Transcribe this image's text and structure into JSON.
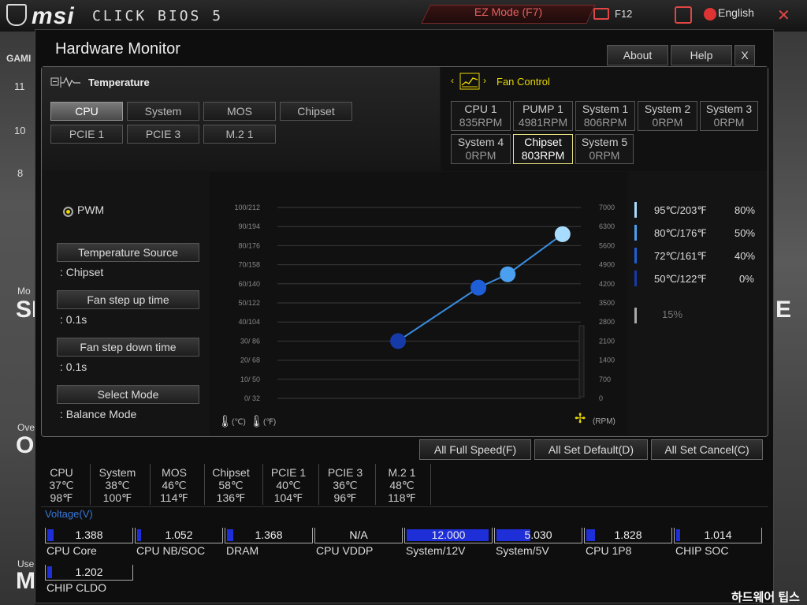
{
  "top": {
    "logo": "msi",
    "product": "CLICK BIOS 5",
    "ez_mode": "EZ Mode (F7)",
    "f12": "F12",
    "language": "English"
  },
  "background": {
    "left_nums": [
      "11",
      "10",
      "8"
    ],
    "left_labels": [
      "GAMI",
      "Mo",
      "SI",
      "Ove",
      "O",
      "Use",
      "M"
    ],
    "right_big": "E"
  },
  "window": {
    "title": "Hardware Monitor",
    "about": "About",
    "help": "Help",
    "close": "X"
  },
  "temperature": {
    "title": "Temperature",
    "sources": [
      "CPU",
      "System",
      "MOS",
      "Chipset",
      "PCIE 1",
      "PCIE 3",
      "M.2 1"
    ],
    "selected": "CPU"
  },
  "fan_control": {
    "title": "Fan Control",
    "fans": [
      {
        "name": "CPU 1",
        "rpm": "835RPM"
      },
      {
        "name": "PUMP 1",
        "rpm": "4981RPM"
      },
      {
        "name": "System 1",
        "rpm": "806RPM"
      },
      {
        "name": "System 2",
        "rpm": "0RPM"
      },
      {
        "name": "System 3",
        "rpm": "0RPM"
      },
      {
        "name": "System 4",
        "rpm": "0RPM"
      },
      {
        "name": "Chipset",
        "rpm": "803RPM"
      },
      {
        "name": "System 5",
        "rpm": "0RPM"
      }
    ],
    "selected": "Chipset"
  },
  "controls": {
    "mode": "PWM",
    "temp_source_label": "Temperature Source",
    "temp_source_value": ": Chipset",
    "step_up_label": "Fan step up time",
    "step_up_value": ": 0.1s",
    "step_down_label": "Fan step down time",
    "step_down_value": ": 0.1s",
    "select_mode_label": "Select Mode",
    "select_mode_value": ": Balance Mode"
  },
  "chart_data": {
    "type": "line",
    "y_left_ticks": [
      "100/212",
      "90/194",
      "80/176",
      "70/158",
      "60/140",
      "50/122",
      "40/104",
      "30/ 86",
      "20/ 68",
      "10/ 50",
      "0/ 32"
    ],
    "y_right_ticks": [
      "7000",
      "6300",
      "5600",
      "4900",
      "4200",
      "3500",
      "2800",
      "2100",
      "1400",
      "700",
      "0"
    ],
    "x_unit_c": "(℃)",
    "x_unit_f": "(℉)",
    "rpm_unit": "(RPM)",
    "points": [
      {
        "temp_c": 50,
        "rpm_pct": 0
      },
      {
        "temp_c": 72,
        "rpm_pct": 40
      },
      {
        "temp_c": 80,
        "rpm_pct": 50
      },
      {
        "temp_c": 95,
        "rpm_pct": 80
      }
    ],
    "legend": [
      {
        "label": "95℃/203℉",
        "pct": "80%",
        "color": "#a8dcff"
      },
      {
        "label": "80℃/176℉",
        "pct": "50%",
        "color": "#4aa0ee"
      },
      {
        "label": "72℃/161℉",
        "pct": "40%",
        "color": "#1e5fd8"
      },
      {
        "label": "50℃/122℉",
        "pct": "0%",
        "color": "#163aa8"
      }
    ],
    "min_duty": "15%"
  },
  "bottom_buttons": {
    "full_speed": "All Full Speed(F)",
    "set_default": "All Set Default(D)",
    "set_cancel": "All Set Cancel(C)"
  },
  "temps": [
    {
      "name": "CPU",
      "c": "37℃",
      "f": "98℉"
    },
    {
      "name": "System",
      "c": "38℃",
      "f": "100℉"
    },
    {
      "name": "MOS",
      "c": "46℃",
      "f": "114℉"
    },
    {
      "name": "Chipset",
      "c": "58℃",
      "f": "136℉"
    },
    {
      "name": "PCIE 1",
      "c": "40℃",
      "f": "104℉"
    },
    {
      "name": "PCIE 3",
      "c": "36℃",
      "f": "96℉"
    },
    {
      "name": "M.2 1",
      "c": "48℃",
      "f": "118℉"
    }
  ],
  "voltage": {
    "title": "Voltage(V)",
    "items": [
      {
        "name": "CPU Core",
        "value": "1.388",
        "fill": 0.07
      },
      {
        "name": "CPU NB/SOC",
        "value": "1.052",
        "fill": 0.05
      },
      {
        "name": "DRAM",
        "value": "1.368",
        "fill": 0.07
      },
      {
        "name": "CPU VDDP",
        "value": "N/A",
        "fill": 0
      },
      {
        "name": "System/12V",
        "value": "12.000",
        "fill": 0.96
      },
      {
        "name": "System/5V",
        "value": "5.030",
        "fill": 0.4
      },
      {
        "name": "CPU 1P8",
        "value": "1.828",
        "fill": 0.1
      },
      {
        "name": "CHIP SOC",
        "value": "1.014",
        "fill": 0.05
      },
      {
        "name": "CHIP CLDO",
        "value": "1.202",
        "fill": 0.06
      }
    ]
  },
  "watermark": "하드웨어 팁스"
}
